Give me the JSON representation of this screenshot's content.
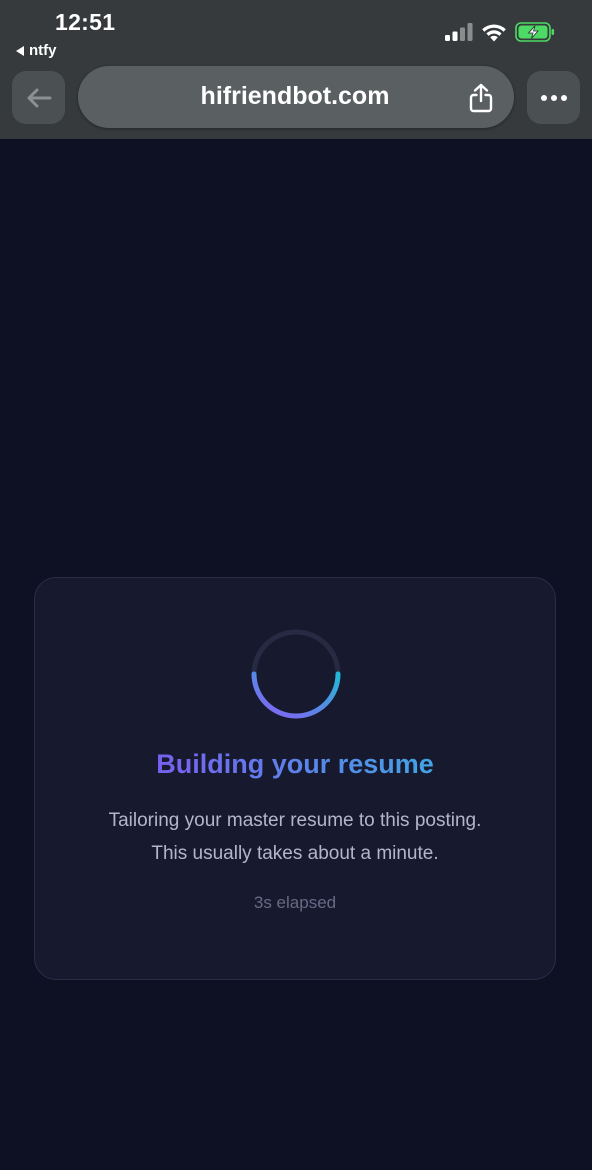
{
  "status_bar": {
    "time": "12:51",
    "back_app_label": "ntfy",
    "icons": [
      "cellular-signal-icon",
      "wifi-icon",
      "battery-charging-icon"
    ],
    "battery_color": "#4cd964"
  },
  "browser": {
    "url": "hifriendbot.com",
    "back_icon": "arrow-left-icon",
    "share_icon": "share-icon",
    "more_icon": "ellipsis-icon"
  },
  "loading_card": {
    "title": "Building your resume",
    "subtitle_line1": "Tailoring your master resume to this posting.",
    "subtitle_line2": "This usually takes about a minute.",
    "elapsed": "3s elapsed",
    "spinner_colors": [
      "#8b5cf6",
      "#22b8d6"
    ],
    "title_gradient": [
      "#7c5cf0",
      "#3fa8e4"
    ]
  },
  "colors": {
    "page_background": "#0e1124",
    "card_background": "#171a2e",
    "chrome_background": "#363a3d"
  }
}
